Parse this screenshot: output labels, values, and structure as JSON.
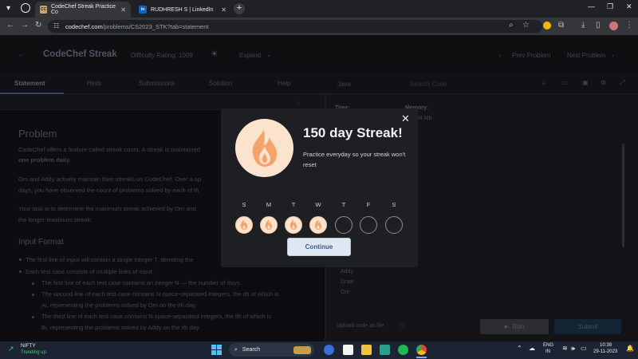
{
  "browser": {
    "tabs": [
      {
        "title": "CodeChef Streak Practice Co",
        "favicon": "CC",
        "active": true
      },
      {
        "title": "RUDHRESH S | LinkedIn",
        "favicon": "in",
        "active": false
      }
    ],
    "url_domain": "codechef.com",
    "url_path": "/problems/CS2023_STK?tab=statement"
  },
  "header": {
    "title": "CodeChef Streak",
    "difficulty": "Difficulty Rating: 1009",
    "expand": "Expand",
    "prev": "Prev Problem",
    "next": "Next Problem"
  },
  "tabs": [
    "Statement",
    "Hints",
    "Submissions",
    "Solution",
    "Help"
  ],
  "language": "Java",
  "search_placeholder": "Search Code",
  "problem": {
    "heading": "Problem",
    "p1": "CodeChef offers a feature called streak count. A streak is maintained",
    "p1b": "one problem daily.",
    "p2": "Om and Addy actively maintain their streaks on CodeChef. Over a sp",
    "p2b": "days, you have observed the count of problems solved by each of th",
    "p3": "Your task is to determine the maximum streak achieved by Om and",
    "p3b": "the longer maximum streak.",
    "input_heading": "Input Format",
    "b1": "The first line of input will contain a single integer T, denoting the",
    "b2": "Each test case consists of multiple lines of input.",
    "b3": "The first line of each test case contains an integer N — the number of days.",
    "b4": "The second line of each test case contains N space-separated integers, the ith of which is",
    "b4b": "Ai, representing the problems solved by Om on the ith day.",
    "b5": "The third line of each test case contains N space-separated integers, the ith of which is",
    "b5b": "Bi, representing the problems solved by Addy on the ith day."
  },
  "right": {
    "time_label": "Time:",
    "memory_label": "Memory:",
    "memory_value": "24 Mb",
    "outputs": [
      "Addy",
      "Draw",
      "Om"
    ],
    "upload": "Upload code as file",
    "run": "Run",
    "submit": "Submit"
  },
  "modal": {
    "title": "150 day Streak!",
    "subtitle": "Practice everyday so your streak won't reset",
    "days": [
      "S",
      "M",
      "T",
      "W",
      "T",
      "F",
      "S"
    ],
    "completed": [
      true,
      true,
      true,
      true,
      false,
      false,
      false
    ],
    "continue": "Continue",
    "accent": "#f6a36a",
    "flame_bg": "#fbe3ce"
  },
  "taskbar": {
    "widget_title": "NIFTY",
    "widget_sub": "Trending up",
    "search": "Search",
    "lang1": "ENG",
    "lang2": "IN",
    "time": "10:39",
    "date": "29-11-2023"
  }
}
